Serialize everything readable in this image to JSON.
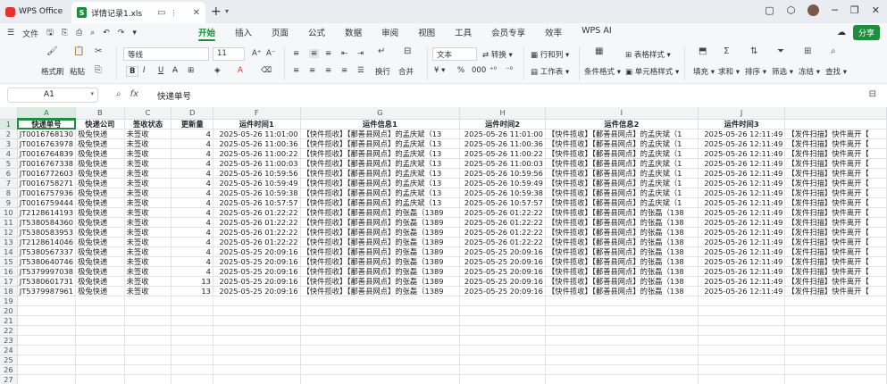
{
  "titlebar": {
    "app_tab": "WPS Office",
    "doc_tab": "详情记录1.xls",
    "xls_badge": "S"
  },
  "menubar": {
    "file_label": "文件",
    "tabs": [
      "开始",
      "插入",
      "页面",
      "公式",
      "数据",
      "审阅",
      "视图",
      "工具",
      "会员专享",
      "效率",
      "WPS AI"
    ],
    "active_tab": "开始",
    "share_label": "分享"
  },
  "ribbon": {
    "format_painter": "格式刷",
    "paste": "粘贴",
    "font_name": "等线",
    "font_size": "11",
    "wrap": "换行",
    "merge": "合并",
    "number_format": "文本",
    "convert": "转换",
    "row_col": "行和列",
    "worksheet": "工作表",
    "cond_format": "条件格式",
    "cell_style": "单元格样式",
    "table_style": "表格样式",
    "fill": "填充",
    "sum": "求和",
    "sort": "排序",
    "filter": "筛选",
    "freeze": "冻结",
    "find": "查找"
  },
  "formulabar": {
    "cell_ref": "A1",
    "fx": "fx",
    "content": "快递单号"
  },
  "grid": {
    "columns": [
      "A",
      "B",
      "C",
      "D",
      "F",
      "G",
      "H",
      "I",
      "J",
      ""
    ],
    "headers": [
      "快递单号",
      "快递公司",
      "签收状态",
      "更新量",
      "运件时间1",
      "运件信息1",
      "运件时间2",
      "运件信息2",
      "运件时间3",
      ""
    ],
    "rows": [
      [
        "JT0016768130",
        "极兔快递",
        "未签收",
        "4",
        "2025-05-26 11:01:00",
        "【快件揽收】【鄱善县网点】的孟庆斌（13",
        "2025-05-26 11:01:00",
        "【快件揽收】【鄱善县网点】的孟庆斌（1",
        "2025-05-26 12:11:49",
        "【发件扫描】快件离开【"
      ],
      [
        "JT0016763978",
        "极兔快递",
        "未签收",
        "4",
        "2025-05-26 11:00:36",
        "【快件揽收】【鄱善县网点】的孟庆斌（13",
        "2025-05-26 11:00:36",
        "【快件揽收】【鄱善县网点】的孟庆斌（1",
        "2025-05-26 12:11:49",
        "【发件扫描】快件离开【"
      ],
      [
        "JT0016764839",
        "极兔快递",
        "未签收",
        "4",
        "2025-05-26 11:00:22",
        "【快件揽收】【鄱善县网点】的孟庆斌（13",
        "2025-05-26 11:00:22",
        "【快件揽收】【鄱善县网点】的孟庆斌（1",
        "2025-05-26 12:11:49",
        "【发件扫描】快件离开【"
      ],
      [
        "JT0016767338",
        "极兔快递",
        "未签收",
        "4",
        "2025-05-26 11:00:03",
        "【快件揽收】【鄱善县网点】的孟庆斌（13",
        "2025-05-26 11:00:03",
        "【快件揽收】【鄱善县网点】的孟庆斌（1",
        "2025-05-26 12:11:49",
        "【发件扫描】快件离开【"
      ],
      [
        "JT0016772603",
        "极兔快递",
        "未签收",
        "4",
        "2025-05-26 10:59:56",
        "【快件揽收】【鄱善县网点】的孟庆斌（13",
        "2025-05-26 10:59:56",
        "【快件揽收】【鄱善县网点】的孟庆斌（1",
        "2025-05-26 12:11:49",
        "【发件扫描】快件离开【"
      ],
      [
        "JT0016758271",
        "极兔快递",
        "未签收",
        "4",
        "2025-05-26 10:59:49",
        "【快件揽收】【鄱善县网点】的孟庆斌（13",
        "2025-05-26 10:59:49",
        "【快件揽收】【鄱善县网点】的孟庆斌（1",
        "2025-05-26 12:11:49",
        "【发件扫描】快件离开【"
      ],
      [
        "JT0016757936",
        "极兔快递",
        "未签收",
        "4",
        "2025-05-26 10:59:38",
        "【快件揽收】【鄱善县网点】的孟庆斌（13",
        "2025-05-26 10:59:38",
        "【快件揽收】【鄱善县网点】的孟庆斌（1",
        "2025-05-26 12:11:49",
        "【发件扫描】快件离开【"
      ],
      [
        "JT0016759444",
        "极兔快递",
        "未签收",
        "4",
        "2025-05-26 10:57:57",
        "【快件揽收】【鄱善县网点】的孟庆斌（13",
        "2025-05-26 10:57:57",
        "【快件揽收】【鄱善县网点】的孟庆斌（1",
        "2025-05-26 12:11:49",
        "【发件扫描】快件离开【"
      ],
      [
        "JT2128614193",
        "极兔快递",
        "未签收",
        "4",
        "2025-05-26 01:22:22",
        "【快件揽收】【鄱善县网点】的张磊（1389",
        "2025-05-26 01:22:22",
        "【快件揽收】【鄱善县网点】的张磊（138",
        "2025-05-26 12:11:49",
        "【发件扫描】快件离开【"
      ],
      [
        "JT5380584360",
        "极兔快递",
        "未签收",
        "4",
        "2025-05-26 01:22:22",
        "【快件揽收】【鄱善县网点】的张磊（1389",
        "2025-05-26 01:22:22",
        "【快件揽收】【鄱善县网点】的张磊（138",
        "2025-05-26 12:11:49",
        "【发件扫描】快件离开【"
      ],
      [
        "JT5380583953",
        "极兔快递",
        "未签收",
        "4",
        "2025-05-26 01:22:22",
        "【快件揽收】【鄱善县网点】的张磊（1389",
        "2025-05-26 01:22:22",
        "【快件揽收】【鄱善县网点】的张磊（138",
        "2025-05-26 12:11:49",
        "【发件扫描】快件离开【"
      ],
      [
        "JT2128614046",
        "极兔快递",
        "未签收",
        "4",
        "2025-05-26 01:22:22",
        "【快件揽收】【鄱善县网点】的张磊（1389",
        "2025-05-26 01:22:22",
        "【快件揽收】【鄱善县网点】的张磊（138",
        "2025-05-26 12:11:49",
        "【发件扫描】快件离开【"
      ],
      [
        "JT5380567337",
        "极兔快递",
        "未签收",
        "4",
        "2025-05-25 20:09:16",
        "【快件揽收】【鄱善县网点】的张磊（1389",
        "2025-05-25 20:09:16",
        "【快件揽收】【鄱善县网点】的张磊（138",
        "2025-05-26 12:11:49",
        "【发件扫描】快件离开【"
      ],
      [
        "JT5380640746",
        "极兔快递",
        "未签收",
        "4",
        "2025-05-25 20:09:16",
        "【快件揽收】【鄱善县网点】的张磊（1389",
        "2025-05-25 20:09:16",
        "【快件揽收】【鄱善县网点】的张磊（138",
        "2025-05-26 12:11:49",
        "【发件扫描】快件离开【"
      ],
      [
        "JT5379997038",
        "极兔快递",
        "未签收",
        "4",
        "2025-05-25 20:09:16",
        "【快件揽收】【鄱善县网点】的张磊（1389",
        "2025-05-25 20:09:16",
        "【快件揽收】【鄱善县网点】的张磊（138",
        "2025-05-26 12:11:49",
        "【发件扫描】快件离开【"
      ],
      [
        "JT5380601731",
        "极兔快递",
        "未签收",
        "13",
        "2025-05-25 20:09:16",
        "【快件揽收】【鄱善县网点】的张磊（1389",
        "2025-05-25 20:09:16",
        "【快件揽收】【鄱善县网点】的张磊（138",
        "2025-05-26 12:11:49",
        "【发件扫描】快件离开【"
      ],
      [
        "JT5379987961",
        "极兔快递",
        "未签收",
        "13",
        "2025-05-25 20:09:16",
        "【快件揽收】【鄱善县网点】的张磊（1389",
        "2025-05-25 20:09:16",
        "【快件揽收】【鄱善县网点】的张磊（138",
        "2025-05-26 12:11:49",
        "【发件扫描】快件离开【"
      ]
    ],
    "total_rows": 28
  }
}
